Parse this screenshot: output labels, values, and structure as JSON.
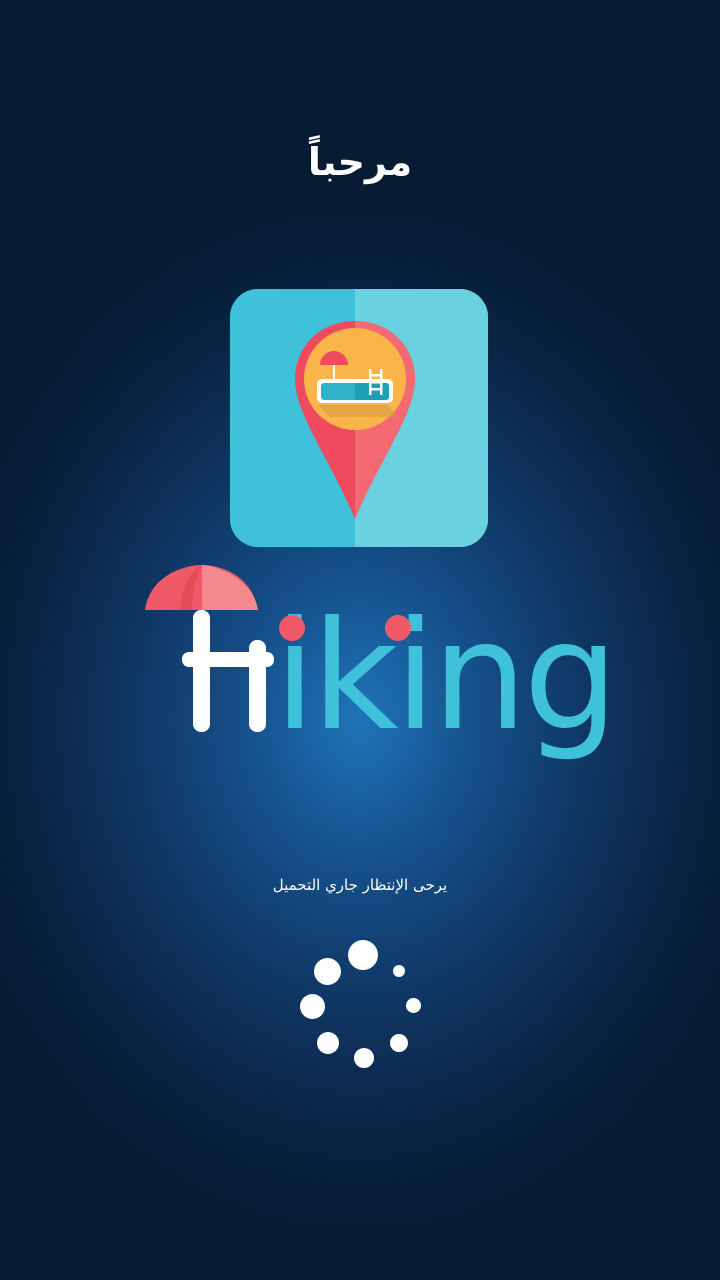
{
  "screen": {
    "welcome_title": "مرحباً",
    "app_name": "Hiking",
    "loading_message": "يرحى الإنتظار جاري التحميل"
  },
  "icons": {
    "app_icon": "map-pin-pool-icon",
    "umbrella": "beach-umbrella-icon",
    "loader": "loading-spinner-icon"
  },
  "colors": {
    "background": "#0f3663",
    "icon_tile": "#3ec1d9",
    "pin": "#ef4a5f",
    "logo_h": "#ffffff",
    "logo_letters": "#3ec1d9",
    "logo_dots": "#f05a68"
  }
}
